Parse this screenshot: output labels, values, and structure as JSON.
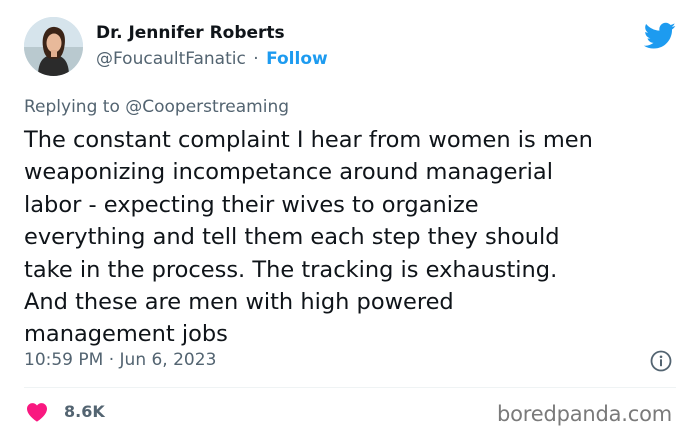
{
  "author": {
    "display_name": "Dr. Jennifer Roberts",
    "handle": "@FoucaultFanatic",
    "separator": "·",
    "follow_label": "Follow"
  },
  "reply": {
    "prefix": "Replying to",
    "mention": "@Cooperstreaming"
  },
  "tweet": {
    "text": "The constant complaint I hear from women is men\nweaponizing incompetance around managerial\nlabor - expecting their wives to organize\neverything and tell them each step they should\ntake in the process. The tracking is exhausting.\nAnd these are men with high powered\nmanagement jobs"
  },
  "meta": {
    "timestamp": "10:59 PM · Jun 6, 2023"
  },
  "engagement": {
    "like_count": "8.6K"
  },
  "watermark": "boredpanda.com",
  "icons": {
    "brand": "twitter-bird-icon",
    "info": "info-icon",
    "like": "heart-icon"
  },
  "colors": {
    "accent": "#1d9bf0",
    "heart": "#f91880",
    "secondary_text": "#536471",
    "primary_text": "#0f1419"
  }
}
